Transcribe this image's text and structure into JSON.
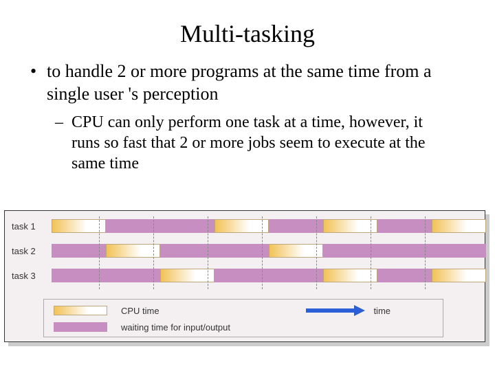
{
  "title": "Multi-tasking",
  "bullets": {
    "b1": "to handle 2 or more programs at the same time from a single user 's perception",
    "b2": "CPU can only perform one task at a time, however, it runs so fast that 2 or more jobs seem to execute at the same time"
  },
  "diagram": {
    "rows": [
      {
        "label": "task 1"
      },
      {
        "label": "task 2"
      },
      {
        "label": "task 3"
      }
    ],
    "legend": {
      "cpu": "CPU time",
      "wait": "waiting time for input/output",
      "time": "time"
    }
  },
  "chart_data": {
    "type": "gantt",
    "title": "Multi-tasking CPU time-slicing",
    "time_axis": {
      "start": 0,
      "end": 8,
      "divisions": [
        1,
        2,
        3,
        4,
        5,
        6,
        7
      ]
    },
    "tasks": [
      {
        "name": "task 1",
        "segments": [
          {
            "type": "cpu",
            "start": 0,
            "end": 1
          },
          {
            "type": "wait",
            "start": 1,
            "end": 3
          },
          {
            "type": "cpu",
            "start": 3,
            "end": 4
          },
          {
            "type": "wait",
            "start": 4,
            "end": 5
          },
          {
            "type": "cpu",
            "start": 5,
            "end": 6
          },
          {
            "type": "wait",
            "start": 6,
            "end": 7
          },
          {
            "type": "cpu",
            "start": 7,
            "end": 8
          }
        ]
      },
      {
        "name": "task 2",
        "segments": [
          {
            "type": "wait",
            "start": 0,
            "end": 1
          },
          {
            "type": "cpu",
            "start": 1,
            "end": 2
          },
          {
            "type": "wait",
            "start": 2,
            "end": 4
          },
          {
            "type": "cpu",
            "start": 4,
            "end": 5
          },
          {
            "type": "wait",
            "start": 5,
            "end": 8
          }
        ]
      },
      {
        "name": "task 3",
        "segments": [
          {
            "type": "wait",
            "start": 0,
            "end": 2
          },
          {
            "type": "cpu",
            "start": 2,
            "end": 3
          },
          {
            "type": "wait",
            "start": 3,
            "end": 5
          },
          {
            "type": "cpu",
            "start": 5,
            "end": 6
          },
          {
            "type": "wait",
            "start": 6,
            "end": 7
          },
          {
            "type": "cpu",
            "start": 7,
            "end": 8
          }
        ]
      }
    ],
    "legend": [
      {
        "key": "cpu",
        "label": "CPU time"
      },
      {
        "key": "wait",
        "label": "waiting time for input/output"
      }
    ]
  }
}
